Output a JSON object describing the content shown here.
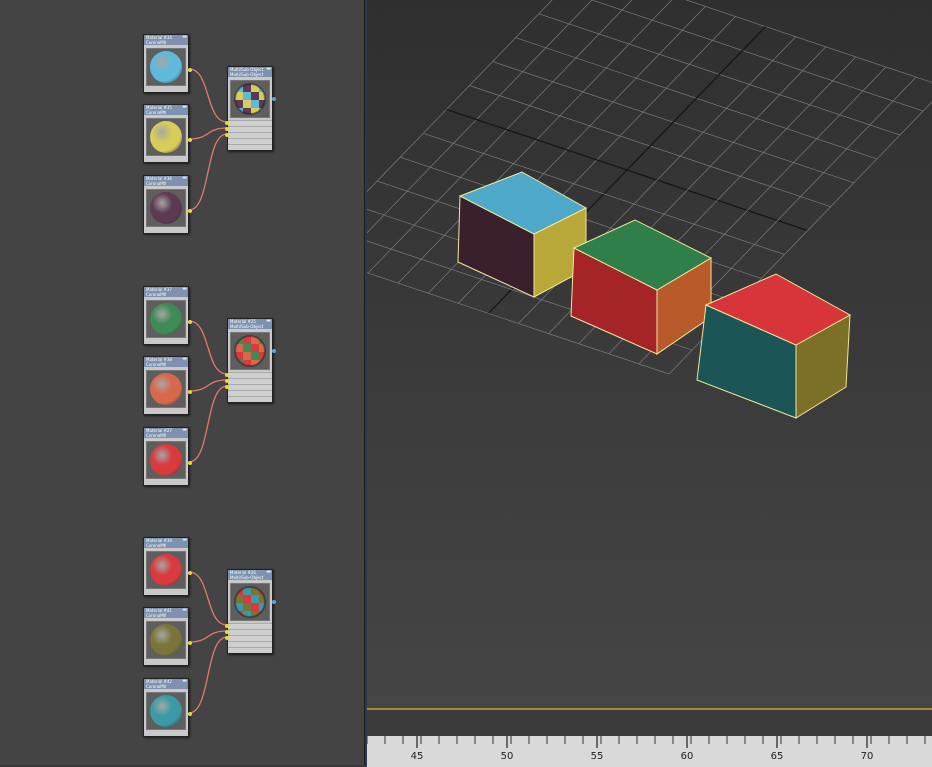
{
  "slate": {
    "groups": [
      {
        "materials": [
          {
            "title": "Material #34",
            "type": "CoronaMtl",
            "color": "#5fb9dc"
          },
          {
            "title": "Material #35",
            "type": "CoronaMtl",
            "color": "#d8cc5a"
          },
          {
            "title": "Material #36",
            "type": "CoronaMtl",
            "color": "#5e3a52"
          }
        ],
        "multi": {
          "title": "Multi/Sub-Object",
          "type": "Multi/Sub-Object"
        }
      },
      {
        "materials": [
          {
            "title": "Material #37",
            "type": "CoronaMtl",
            "color": "#3f8a55"
          },
          {
            "title": "Material #38",
            "type": "CoronaMtl",
            "color": "#d8684a"
          },
          {
            "title": "Material #27",
            "type": "CoronaMtl",
            "color": "#d83a3e"
          }
        ],
        "multi": {
          "title": "Material #25",
          "type": "Multi/Sub-Object"
        }
      },
      {
        "materials": [
          {
            "title": "Material #39",
            "type": "CoronaMtl",
            "color": "#d83a3e"
          },
          {
            "title": "Material #41",
            "type": "CoronaMtl",
            "color": "#7a7438"
          },
          {
            "title": "Material #42",
            "type": "CoronaMtl",
            "color": "#3a9aa5"
          }
        ],
        "multi": {
          "title": "Material #26",
          "type": "Multi/Sub-Object"
        }
      }
    ]
  },
  "viewport": {
    "boxes": [
      {
        "top": "#4fa9c9",
        "front": "#3a1f2c",
        "side": "#b8a83a"
      },
      {
        "top": "#2f7f4a",
        "front": "#a52427",
        "side": "#b85a2a"
      },
      {
        "top": "#d8353a",
        "front": "#1c5555",
        "side": "#7c7028"
      }
    ],
    "selection_color": "#f0e89a"
  },
  "timeline": {
    "ticks": [
      "45",
      "50",
      "55",
      "60",
      "65",
      "70"
    ],
    "accent_color": "#a88a2a"
  }
}
